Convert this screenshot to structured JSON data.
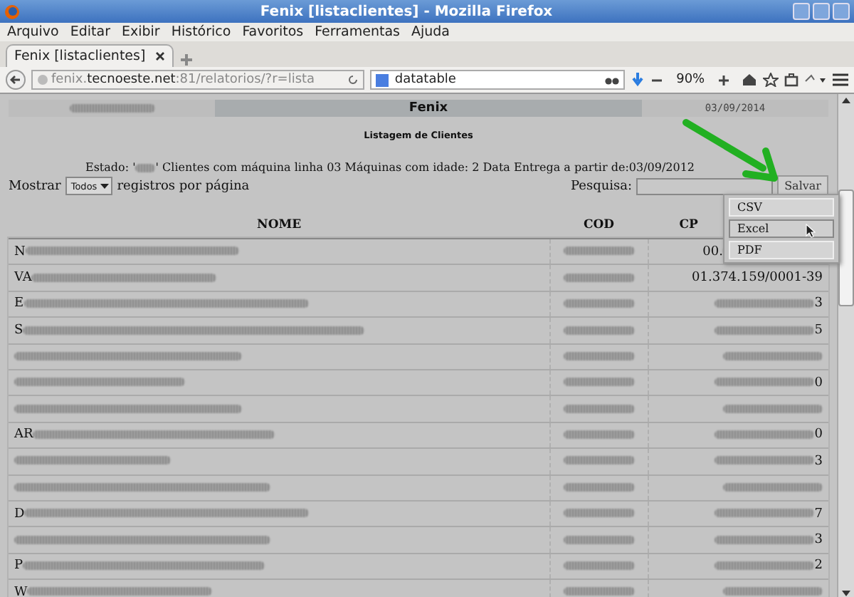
{
  "window": {
    "title": "Fenix [listaclientes] - Mozilla Firefox"
  },
  "menu": [
    "Arquivo",
    "Editar",
    "Exibir",
    "Histórico",
    "Favoritos",
    "Ferramentas",
    "Ajuda"
  ],
  "tabs": [
    {
      "label": "Fenix [listaclientes]",
      "selected": true
    }
  ],
  "address": {
    "prefix": "fenix.",
    "domain": "tecnoeste.net",
    "path": ":81/relatorios/?r=lista"
  },
  "web_search": {
    "value": "datatable"
  },
  "zoom": "90%",
  "report": {
    "banner": {
      "title": "Fenix",
      "date": "03/09/2014"
    },
    "title": "Listagem de Clientes",
    "filter": {
      "before": "Estado: '",
      "after": "' Clientes com máquina linha 03 Máquinas com idade: 2 Data Entrega a partir de:03/09/2012"
    },
    "length": {
      "before": "Mostrar",
      "value": "Todos",
      "after": "registros por página"
    },
    "search": {
      "label": "Pesquisa:"
    },
    "save_button": "Salvar",
    "export_menu": [
      {
        "label": "CSV",
        "selected": false
      },
      {
        "label": "Excel",
        "selected": true
      },
      {
        "label": "PDF",
        "selected": false
      }
    ],
    "columns": [
      "NOME",
      "COD",
      "CP"
    ],
    "rows": [
      {
        "name": "N",
        "cpf": "00."
      },
      {
        "name": "VA",
        "cpf": "01.374.159/0001-39"
      },
      {
        "name": "E",
        "cpf": "3"
      },
      {
        "name": "S",
        "cpf": "5"
      },
      {
        "name": "",
        "cpf": ""
      },
      {
        "name": "",
        "cpf": "0"
      },
      {
        "name": "",
        "cpf": ""
      },
      {
        "name": "AR",
        "cpf": "0"
      },
      {
        "name": "",
        "cpf": "3"
      },
      {
        "name": "",
        "cpf": ""
      },
      {
        "name": "D",
        "cpf": "7"
      },
      {
        "name": "",
        "cpf": "3"
      },
      {
        "name": "P",
        "cpf": "2"
      },
      {
        "name": "W",
        "cpf": ""
      }
    ]
  }
}
